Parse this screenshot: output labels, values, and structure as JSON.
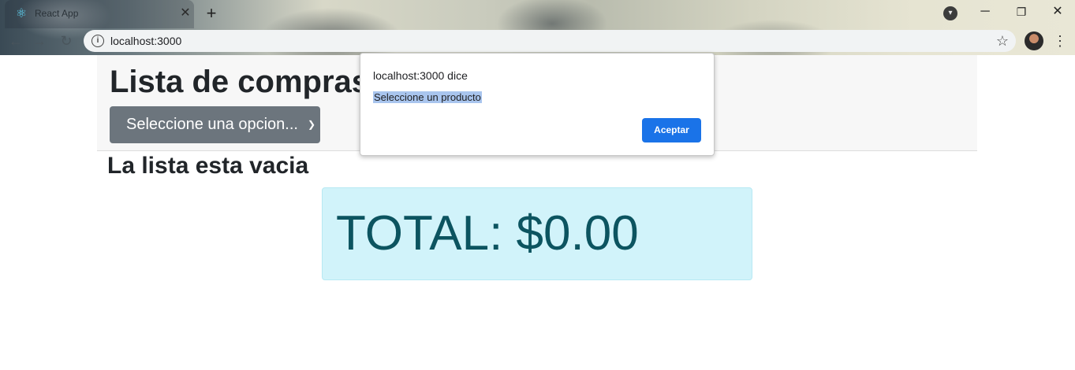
{
  "browser": {
    "tab_title": "React App",
    "url": "localhost:3000"
  },
  "app": {
    "title": "Lista de compras",
    "select_value": "Seleccione una opcion...",
    "empty_message": "La lista esta vacia",
    "total_label": "TOTAL:",
    "total_amount": "$0.00"
  },
  "dialog": {
    "title": "localhost:3000 dice",
    "message": "Seleccione un producto",
    "ok_label": "Aceptar"
  },
  "colors": {
    "select_bg": "#6c757d",
    "total_bg": "#d1f3fa",
    "total_text": "#0c5460",
    "dialog_button": "#1a73e8"
  }
}
